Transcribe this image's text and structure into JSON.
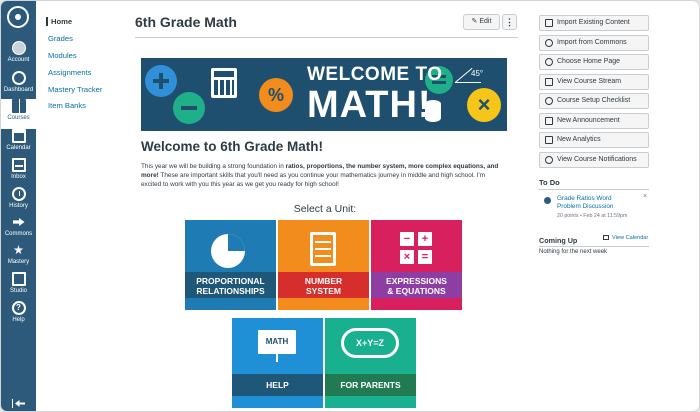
{
  "global_nav": {
    "items": [
      {
        "label": "Account",
        "icon": "avatar-icon"
      },
      {
        "label": "Dashboard",
        "icon": "dashboard-icon"
      },
      {
        "label": "Courses",
        "icon": "book-icon"
      },
      {
        "label": "Calendar",
        "icon": "calendar-icon"
      },
      {
        "label": "Inbox",
        "icon": "inbox-icon"
      },
      {
        "label": "History",
        "icon": "clock-icon"
      },
      {
        "label": "Commons",
        "icon": "commons-icon"
      },
      {
        "label": "Mastery",
        "icon": "star-icon"
      },
      {
        "label": "Studio",
        "icon": "studio-icon"
      },
      {
        "label": "Help",
        "icon": "help-icon"
      }
    ]
  },
  "course_nav": {
    "items": [
      "Home",
      "Grades",
      "Modules",
      "Assignments",
      "Mastery Tracker",
      "Item Banks"
    ]
  },
  "header": {
    "title": "6th Grade Math",
    "edit_label": "Edit",
    "more_label": "⋮"
  },
  "banner": {
    "line1": "WELCOME TO",
    "line2": "MATH!",
    "angle": "45°"
  },
  "content": {
    "welcome": "Welcome to 6th Grade Math!",
    "intro_1": "This year we will be building a strong foundation in ",
    "intro_bold": "ratios, proportions, the number system, more complex equations, and more!",
    "intro_2": " These are important skills that you'll need as you continue your mathematics journey in middle and high school.  I'm excited to work with you this year as we get you ready for high school!",
    "select_unit": "Select a Unit:"
  },
  "units": [
    {
      "line1": "PROPORTIONAL",
      "line2": "RELATIONSHIPS",
      "color": "#1f7bb4",
      "band": "#1e5778"
    },
    {
      "line1": "NUMBER",
      "line2": "SYSTEM",
      "color": "#f28c1c",
      "band": "#d62d2d"
    },
    {
      "line1": "EXPRESSIONS",
      "line2": "& EQUATIONS",
      "color": "#d8205f",
      "band": "#8e3ea3"
    },
    {
      "line1": "HELP",
      "line2": "",
      "color": "#1f8fd6",
      "band": "#1e5778",
      "icon_text": "MATH"
    },
    {
      "line1": "FOR PARENTS",
      "line2": "",
      "color": "#19b08f",
      "band": "#217a52",
      "icon_text": "X+Y=Z"
    }
  ],
  "sidebar": {
    "buttons": [
      "Import Existing Content",
      "Import from Commons",
      "Choose Home Page",
      "View Course Stream",
      "Course Setup Checklist",
      "New Announcement",
      "New Analytics",
      "View Course Notifications"
    ],
    "todo_heading": "To Do",
    "todo_title": "Grade Ratios Word Problem Discussion",
    "todo_meta": "20 points • Feb 24 at 11:59pm",
    "todo_close": "×",
    "coming_up_heading": "Coming Up",
    "view_calendar": "View Calendar",
    "nothing": "Nothing for the next week"
  },
  "colors": {
    "global_nav": "#2d5a7b",
    "link": "#0770a3",
    "text": "#2d3b45",
    "banner": "#1f4f6f"
  }
}
